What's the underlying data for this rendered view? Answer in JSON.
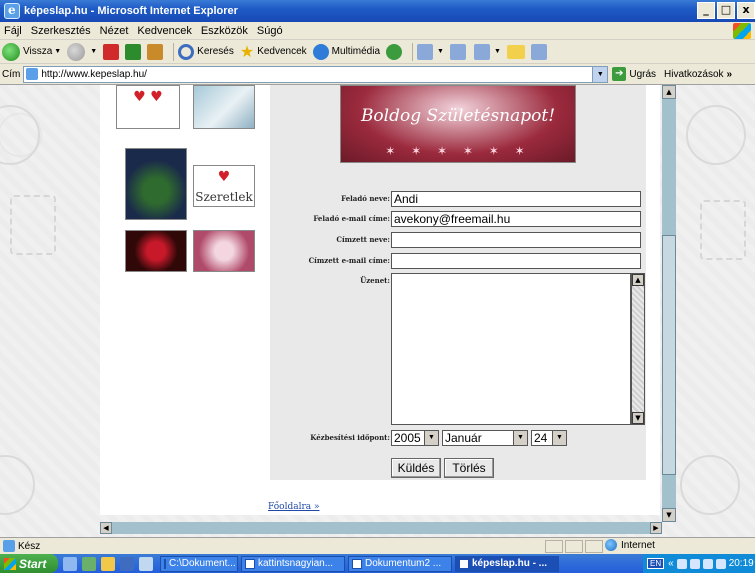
{
  "window": {
    "title": "képeslap.hu - Microsoft Internet Explorer",
    "controls": [
      "_",
      "□",
      "x"
    ]
  },
  "menu": [
    "Fájl",
    "Szerkesztés",
    "Nézet",
    "Kedvencek",
    "Eszközök",
    "Súgó"
  ],
  "toolbar": {
    "back_label": "Vissza",
    "search_label": "Keresés",
    "favorites_label": "Kedvencek",
    "media_label": "Multimédia"
  },
  "address": {
    "label": "Cím",
    "url": "http://www.kepeslap.hu/",
    "go_label": "Ugrás",
    "links_label": "Hivatkozások"
  },
  "thumbnails": {
    "szeretlek_caption": "Szeretlek"
  },
  "banner": {
    "text": "Boldog Születésnapot!"
  },
  "form": {
    "sender_name_label": "Feladó neve:",
    "sender_name_value": "Andi",
    "sender_email_label": "Feladó e-mail címe:",
    "sender_email_value": "avekony@freemail.hu",
    "recipient_name_label": "Címzett neve:",
    "recipient_name_value": "",
    "recipient_email_label": "Címzett e-mail címe:",
    "recipient_email_value": "",
    "message_label": "Üzenet:",
    "message_value": "",
    "delivery_label": "Kézbesítési időpont:",
    "year": "2005",
    "month": "Január",
    "day": "24",
    "send_label": "Küldés",
    "clear_label": "Törlés"
  },
  "home_link": "Főoldalra »",
  "status": {
    "text": "Kész",
    "zone": "Internet"
  },
  "taskbar": {
    "start_label": "Start",
    "tasks": [
      {
        "label": "C:\\Dokument...",
        "active": false
      },
      {
        "label": "kattintsnagyian...",
        "active": false
      },
      {
        "label": "Dokumentum2 ...",
        "active": false
      },
      {
        "label": "képeslap.hu - ...",
        "active": true
      }
    ],
    "lang": "EN",
    "clock": "20:19"
  }
}
